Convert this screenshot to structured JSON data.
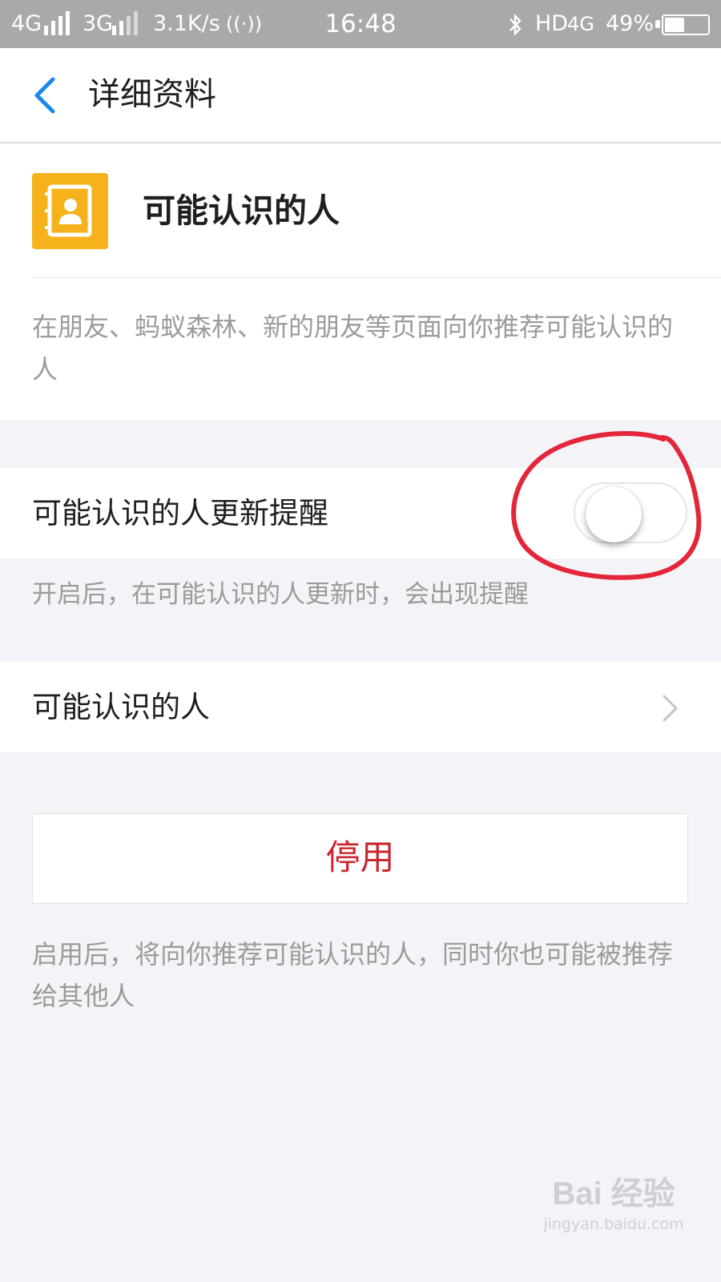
{
  "status_bar": {
    "network1": "4G",
    "network2": "3G",
    "speed": "3.1K/s",
    "hotspot": "((·))",
    "time": "16:48",
    "hd": "HD",
    "net_type": "4G",
    "battery_pct": "49%",
    "battery_level": 0.49,
    "icons": [
      "signal-icon",
      "bluetooth-icon",
      "battery-icon"
    ]
  },
  "nav": {
    "back_icon": "chevron-left-icon",
    "title": "详细资料",
    "accent_color": "#1a8ae8"
  },
  "header": {
    "icon": "contact-book-icon",
    "icon_color": "#f5b21a",
    "name": "可能认识的人",
    "description": "在朋友、蚂蚁森林、新的朋友等页面向你推荐可能认识的人"
  },
  "toggle_row": {
    "label": "可能认识的人更新提醒",
    "enabled": false,
    "hint": "开启后，在可能认识的人更新时，会出现提醒"
  },
  "list_row": {
    "label": "可能认识的人",
    "icon": "chevron-right-icon"
  },
  "disable_button": {
    "label": "停用",
    "color": "#c8272f"
  },
  "disable_hint": "启用后，将向你推荐可能认识的人，同时你也可能被推荐给其他人",
  "annotation": {
    "shape": "hand-drawn circle",
    "color": "#e3263a"
  },
  "watermark": {
    "logo": "Bai 经验",
    "url": "jingyan.baidu.com"
  }
}
